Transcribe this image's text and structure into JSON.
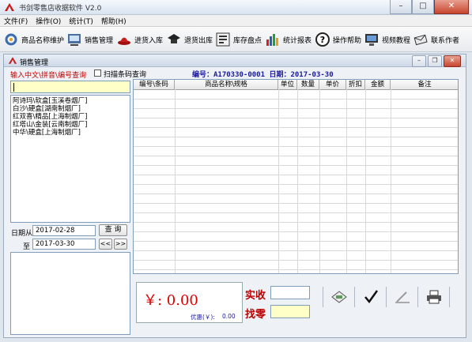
{
  "app": {
    "title": "书剑零售店收据软件 V2.0"
  },
  "menu": [
    "文件(F)",
    "操作(O)",
    "统计(T)",
    "帮助(H)"
  ],
  "toolbar": [
    {
      "label": "商品名称维护",
      "icon": "product-maintain-icon"
    },
    {
      "label": "销售管理",
      "icon": "sales-manage-icon"
    },
    {
      "label": "进货入库",
      "icon": "stock-in-icon"
    },
    {
      "label": "退货出库",
      "icon": "return-out-icon"
    },
    {
      "label": "库存盘点",
      "icon": "inventory-check-icon"
    },
    {
      "label": "统计报表",
      "icon": "stat-report-icon"
    },
    {
      "label": "操作帮助",
      "icon": "help-icon"
    },
    {
      "label": "视频教程",
      "icon": "video-tutorial-icon"
    },
    {
      "label": "联系作者",
      "icon": "contact-author-icon"
    }
  ],
  "child": {
    "title": "销售管理",
    "hint": "输入中文\\拼音\\编号查询",
    "scan_label": "扫描条码查询",
    "order_info": "编号：A170330-0001 日期：2017-03-30"
  },
  "product_list": [
    "阿诗玛\\软盒[玉溪卷烟厂]",
    "白沙\\硬盒[湖南制烟厂]",
    "红双喜\\精品[上海制烟厂]",
    "红塔山\\金装[云南制烟厂]",
    "中华\\硬盒[上海制烟厂]"
  ],
  "filter": {
    "date_from_label": "日期从",
    "date_from": "2017-02-28",
    "date_to_label": "至",
    "date_to": "2017-03-30",
    "query_label": "查  询",
    "prev_label": "<<",
    "next_label": ">>"
  },
  "grid_columns": [
    "编号\\条码",
    "商品名称\\规格",
    "单位",
    "数量",
    "单价",
    "折扣",
    "金额",
    "备注"
  ],
  "totals": {
    "amount": "￥: 0.00",
    "discount_label": "优惠(￥):",
    "discount_value": "0.00",
    "received_label": "实收",
    "change_label": "找零"
  },
  "colors": {
    "accent_red": "#c00000",
    "input_yellow": "#ffffc8",
    "info_blue": "#1a1aa0"
  }
}
